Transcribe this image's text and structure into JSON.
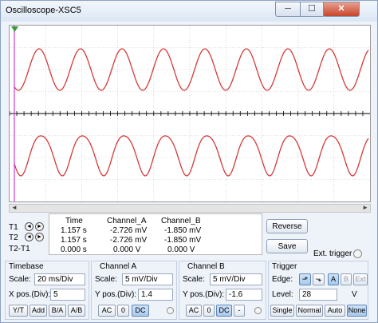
{
  "window": {
    "title": "Oscilloscope-XSC5",
    "minimize_icon": "─",
    "maximize_icon": "☐",
    "close_icon": "✕"
  },
  "colors": {
    "trace": "#d43a3a",
    "screen_bg": "#ffffff",
    "grid": "#bfbfbf",
    "cursor1": "#d23bd2",
    "axis": "#000000"
  },
  "cursors": {
    "t1_label": "T1",
    "t2_label": "T2",
    "diff_label": "T2-T1",
    "left_arrow": "◄",
    "right_arrow": "►",
    "headers": {
      "time": "Time",
      "channel_a": "Channel_A",
      "channel_b": "Channel_B"
    },
    "rows": [
      {
        "time": "1.157 s",
        "a": "-2.726 mV",
        "b": "-1.850 mV"
      },
      {
        "time": "1.157 s",
        "a": "-2.726 mV",
        "b": "-1.850 mV"
      },
      {
        "time": "0.000 s",
        "a": "0.000 V",
        "b": "0.000 V"
      }
    ]
  },
  "buttons": {
    "reverse": "Reverse",
    "save": "Save",
    "ext_trigger": "Ext. trigger"
  },
  "timebase": {
    "title": "Timebase",
    "scale_label": "Scale:",
    "scale_value": "20 ms/Div",
    "xpos_label": "X pos.(Div):",
    "xpos_value": "5",
    "modes": [
      "Y/T",
      "Add",
      "B/A",
      "A/B"
    ],
    "active_mode": "Y/T"
  },
  "channel_a": {
    "title": "Channel A",
    "scale_label": "Scale:",
    "scale_value": "5 mV/Div",
    "ypos_label": "Y pos.(Div):",
    "ypos_value": "1.4",
    "couplings": [
      "AC",
      "0",
      "DC"
    ],
    "active_coupling": "DC"
  },
  "channel_b": {
    "title": "Channel B",
    "scale_label": "Scale:",
    "scale_value": "5 mV/Div",
    "ypos_label": "Y pos.(Div):",
    "ypos_value": "-1.6",
    "couplings": [
      "AC",
      "0",
      "DC",
      "-"
    ],
    "active_coupling": "DC"
  },
  "trigger": {
    "title": "Trigger",
    "edge_label": "Edge:",
    "level_label": "Level:",
    "level_value": "28",
    "level_unit": "V",
    "edge_rising": "⬏",
    "edge_falling": "⬎",
    "sources": [
      "A",
      "B",
      "Ext"
    ],
    "active_source": "A",
    "modes": [
      "Single",
      "Normal",
      "Auto",
      "None"
    ],
    "active_mode": "None"
  }
}
